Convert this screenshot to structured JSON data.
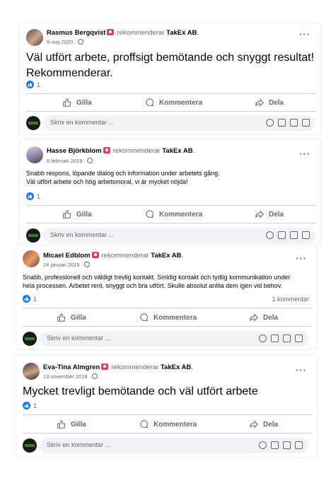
{
  "company": "TakEx AB",
  "rec_verb": "rekommenderar",
  "comment_placeholder": "Skriv en kommentar ...",
  "actions": {
    "like": "Gilla",
    "comment": "Kommentera",
    "share": "Dela"
  },
  "posts": [
    {
      "author": "Rasmus Bergqvist",
      "date": "9 maj 2020 ·",
      "text": "Väl utfört arbete, proffsigt bemötande och snyggt resultat!\nRekommenderar.",
      "likes": "1",
      "comments": ""
    },
    {
      "author": "Hasse Björkblom",
      "date": "6 februari 2019 ·",
      "text": "Snabb respons, löpande dialog och information under arbetets gång.\nVäl utfört arbete och hög arbetsmoral, vi är mycket nöjda!",
      "likes": "1",
      "comments": ""
    },
    {
      "author": "Micael Edblom",
      "date": "24 januari 2019 ·",
      "text": "Snabb, professionell och väldigt trevlig kontakt. Smidig kontakt och tydlig kommunikation under\nhela processen. Arbetet rent, snyggt och bra utfört. Skulle absolut anlita dem igen vid behov.",
      "likes": "1",
      "comments": "1 kommentar"
    },
    {
      "author": "Eva-Tina Almgren",
      "date": "13 november 2018 ·",
      "text": "Mycket trevligt bemötande och väl utfört arbete",
      "likes": "1",
      "comments": ""
    }
  ]
}
